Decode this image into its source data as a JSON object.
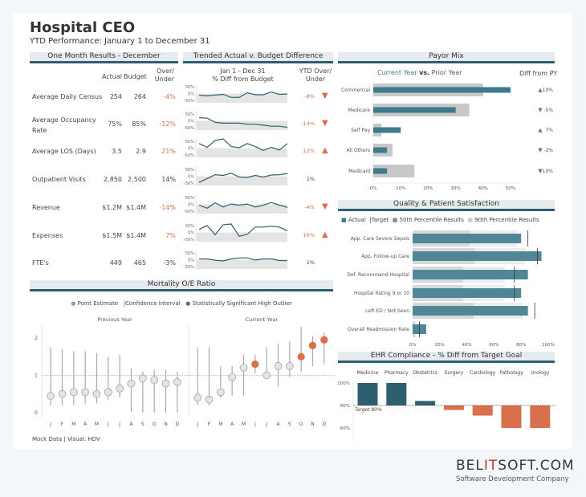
{
  "header": {
    "title": "Hospital CEO",
    "subtitle": "YTD Performance: January 1 to December 31"
  },
  "colors": {
    "teal": "#3d7a8a",
    "teal_dark": "#2e5f6e",
    "orange": "#d9704c",
    "grey_bar": "#c8c8c8",
    "light_grey": "#e4e4e4"
  },
  "one_month": {
    "band_title": "One Month Results - December",
    "col_actual": "Actual",
    "col_budget": "Budget",
    "col_over_1": "Over/",
    "col_over_2": "Under",
    "rows": [
      {
        "metric": "Average Daily Census",
        "actual": "254",
        "budget": "264",
        "over": "-4%",
        "over_color": "orange"
      },
      {
        "metric": "Average Occupancy Rate",
        "actual": "75%",
        "budget": "85%",
        "over": "-12%",
        "over_color": "orange"
      },
      {
        "metric": "Average LOS (Days)",
        "actual": "3.5",
        "budget": "2.9",
        "over": "21%",
        "over_color": "orange"
      },
      {
        "metric": "Outpatient Visits",
        "actual": "2,850",
        "budget": "2,500",
        "over": "14%",
        "over_color": "grey"
      },
      {
        "metric": "Revenue",
        "actual": "$1.2M",
        "budget": "$1.4M",
        "over": "-14%",
        "over_color": "orange"
      },
      {
        "metric": "Expenses",
        "actual": "$1.5M",
        "budget": "$1.4M",
        "over": "7%",
        "over_color": "orange"
      },
      {
        "metric": "FTE's",
        "actual": "449",
        "budget": "465",
        "over": "-3%",
        "over_color": "grey"
      }
    ]
  },
  "trended": {
    "band_title": "Trended Actual v. Budget Difference",
    "col_range_1": "Jan 1 - Dec 31",
    "col_range_2": "% Diff from Budget",
    "col_ytd_1": "YTD Over/",
    "col_ytd_2": "Under",
    "axis_ticks": [
      "50%",
      "0%",
      "-50%"
    ],
    "rows": [
      {
        "ytd": "-8%",
        "ytd_color": "orange",
        "arrow": "down",
        "series": [
          -10,
          -15,
          -10,
          -5,
          -25,
          -25,
          5,
          -8,
          -8,
          10,
          -5,
          -3
        ]
      },
      {
        "ytd": "-14%",
        "ytd_color": "orange",
        "arrow": "down",
        "series": [
          20,
          18,
          -10,
          -15,
          -15,
          -15,
          -22,
          -22,
          -28,
          -35,
          -35,
          -42
        ]
      },
      {
        "ytd": "12%",
        "ytd_color": "orange",
        "arrow": "up",
        "series": [
          30,
          5,
          50,
          60,
          10,
          3,
          30,
          10,
          -15,
          5,
          -12,
          30
        ]
      },
      {
        "ytd": "1%",
        "ytd_color": "grey",
        "arrow": "none",
        "series": [
          -40,
          -15,
          10,
          5,
          20,
          -5,
          -8,
          5,
          -5,
          8,
          10,
          18
        ]
      },
      {
        "ytd": "-4%",
        "ytd_color": "orange",
        "arrow": "down",
        "series": [
          -5,
          -25,
          10,
          -18,
          2,
          -5,
          2,
          -18,
          -5,
          12,
          -5,
          -20
        ]
      },
      {
        "ytd": "16%",
        "ytd_color": "orange",
        "arrow": "up",
        "series": [
          20,
          45,
          -15,
          50,
          55,
          -25,
          -12,
          35,
          35,
          40,
          35,
          10
        ]
      },
      {
        "ytd": "1%",
        "ytd_color": "grey",
        "arrow": "none",
        "series": [
          5,
          5,
          -3,
          -8,
          5,
          12,
          12,
          -2,
          5,
          5,
          -5,
          -5
        ]
      }
    ]
  },
  "mortality": {
    "band_title": "Mortality O/E Ratio",
    "legend": [
      "Point Estimate",
      "Confidence Interval",
      "Statistically Significant High Outlier"
    ],
    "footer": "Mock Data | Visual: HDV"
  },
  "payor": {
    "band_title": "Payor Mix",
    "legend_current": "Current Year",
    "legend_vs": "vs.",
    "legend_prior": "Prior Year",
    "diff_header": "Diff from PY"
  },
  "quality": {
    "band_title": "Quality & Patient Satisfaction",
    "legend": [
      "Actual",
      "Target",
      "50th Percentile Results",
      "90th Percentile Results"
    ]
  },
  "ehr": {
    "band_title": "EHR Compliance - % Diff from Target Goal",
    "target_label": "Target 80%"
  },
  "brand": {
    "logo_pre": "BEL",
    "logo_it": "IT",
    "logo_post": "SOFT.COM",
    "tagline": "Software Development Company"
  },
  "chart_data": [
    {
      "type": "scatter",
      "title": "Mortality O/E Ratio",
      "panels": [
        "Previous Year",
        "Current Year"
      ],
      "categories": [
        "J",
        "F",
        "M",
        "A",
        "M",
        "J",
        "J",
        "A",
        "S",
        "O",
        "N",
        "D"
      ],
      "yticks": [
        "0",
        "1",
        "2"
      ],
      "ylim": [
        0,
        2.3
      ],
      "reference_line": 1,
      "series": [
        {
          "name": "Previous Year",
          "point": [
            0.45,
            0.5,
            0.55,
            0.55,
            0.5,
            0.55,
            0.65,
            0.78,
            0.92,
            0.88,
            0.78,
            0.82
          ],
          "low": [
            0.2,
            0.2,
            0.2,
            0.25,
            0.25,
            0.35,
            0.4,
            0.02,
            0.0,
            0.0,
            0.0,
            0.0
          ],
          "high": [
            1.75,
            1.7,
            1.65,
            1.65,
            1.6,
            1.5,
            1.55,
            1.2,
            1.1,
            1.15,
            1.15,
            1.1
          ],
          "outlier": [
            false,
            false,
            false,
            false,
            false,
            false,
            false,
            false,
            false,
            false,
            false,
            false
          ]
        },
        {
          "name": "Current Year",
          "point": [
            0.4,
            0.35,
            0.55,
            0.95,
            1.2,
            1.3,
            1.0,
            1.25,
            1.25,
            1.5,
            1.8,
            1.95
          ],
          "low": [
            0.2,
            0.2,
            0.4,
            0.45,
            0.45,
            1.05,
            1.0,
            0.7,
            0.95,
            1.1,
            1.25,
            1.3
          ],
          "high": [
            1.75,
            1.75,
            1.25,
            1.25,
            1.55,
            1.55,
            1.75,
            1.85,
            1.9,
            2.55,
            2.05,
            2.15
          ],
          "outlier": [
            false,
            false,
            false,
            false,
            false,
            true,
            false,
            false,
            false,
            true,
            true,
            true
          ]
        }
      ]
    },
    {
      "type": "bar",
      "title": "Payor Mix",
      "categories": [
        "Commercial",
        "Medicare",
        "Self Pay",
        "All Others",
        "Medicaid"
      ],
      "series": [
        {
          "name": "Current Year",
          "values": [
            50,
            30,
            10,
            5,
            5
          ]
        },
        {
          "name": "Prior Year",
          "values": [
            40,
            35,
            3,
            7,
            15
          ]
        }
      ],
      "diff_from_py": [
        {
          "dir": "up",
          "label": "10%"
        },
        {
          "dir": "down",
          "label": "-5%"
        },
        {
          "dir": "up",
          "label": "7%"
        },
        {
          "dir": "down",
          "label": "-2%"
        },
        {
          "dir": "down",
          "label": "-10%"
        }
      ],
      "xticks": [
        "0%",
        "10%",
        "20%",
        "30%",
        "40%",
        "50%"
      ],
      "xlim": [
        0,
        52
      ]
    },
    {
      "type": "bar",
      "title": "Quality & Patient Satisfaction",
      "categories": [
        "App. Care Severe Sepsis",
        "App. Follow-up Care",
        "Def. Recommend Hospital",
        "Hospital Rating 9 or 10",
        "Left ED / Not Seen",
        "Overall Readmission Rate"
      ],
      "series": [
        {
          "name": "Actual",
          "values": [
            80,
            95,
            85,
            80,
            85,
            10
          ]
        },
        {
          "name": "Target",
          "values": [
            85,
            92,
            75,
            75,
            90,
            5
          ]
        },
        {
          "name": "50th Percentile Results",
          "values": [
            42,
            46,
            37,
            37,
            45,
            2
          ]
        },
        {
          "name": "90th Percentile Results",
          "values": [
            77,
            83,
            68,
            68,
            81,
            2
          ]
        }
      ],
      "xticks": [
        "0%",
        "20%",
        "40%",
        "60%",
        "80%",
        "100%"
      ],
      "xlim": [
        0,
        100
      ]
    },
    {
      "type": "bar",
      "title": "EHR Compliance - % Diff from Target Goal",
      "categories": [
        "Medicine",
        "Pharmacy",
        "Obstetrics",
        "Surgery",
        "Cardiology",
        "Pathology",
        "Urology"
      ],
      "values": [
        100,
        100,
        84,
        76,
        71,
        60,
        60
      ],
      "baseline": 80,
      "yticks": [
        "100%",
        "80%",
        "60%"
      ],
      "ylim": [
        55,
        105
      ]
    }
  ]
}
